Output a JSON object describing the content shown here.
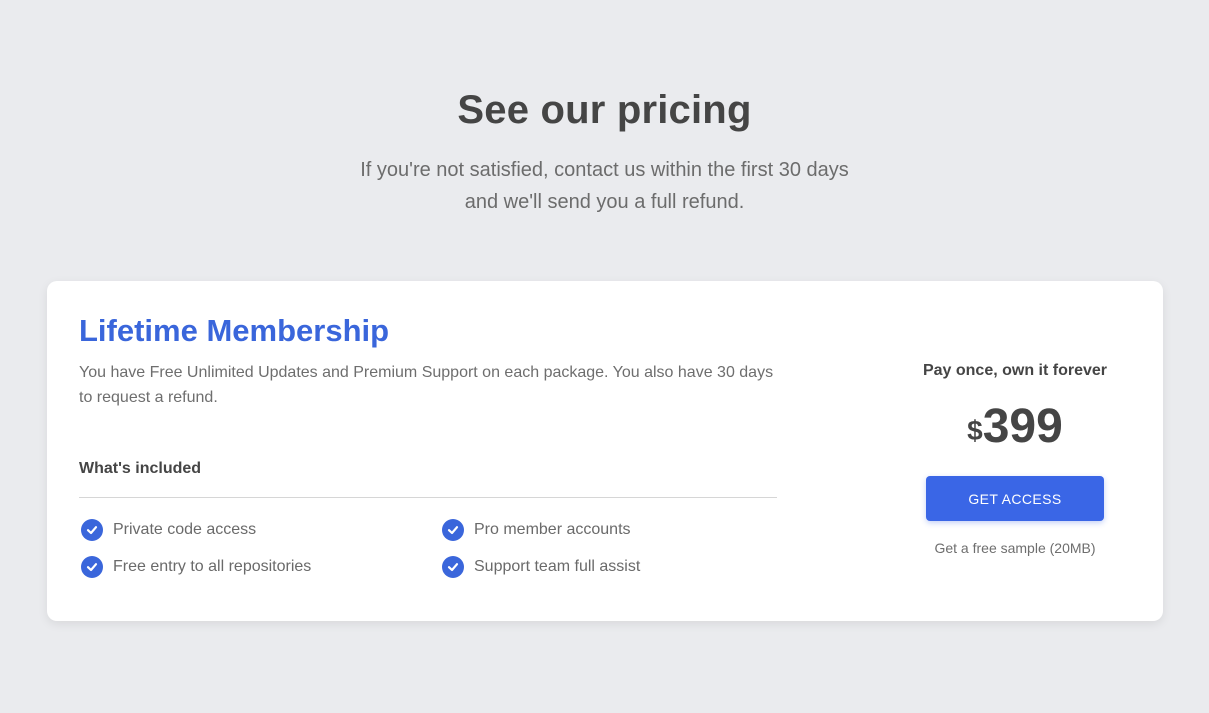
{
  "header": {
    "title": "See our pricing",
    "subtitle_line1": "If you're not satisfied, contact us within the first 30 days",
    "subtitle_line2": "and we'll send you a full refund."
  },
  "plan": {
    "name": "Lifetime Membership",
    "description": "You have Free Unlimited Updates and Premium Support on each package. You also have 30 days to request a refund.",
    "included_heading": "What's included",
    "features": [
      "Private code access",
      "Pro member accounts",
      "Free entry to all repositories",
      "Support team full assist"
    ],
    "pay_once_label": "Pay once, own it forever",
    "currency": "$",
    "price": "399",
    "cta_label": "GET ACCESS",
    "sample_link": "Get a free sample (20MB)"
  },
  "colors": {
    "accent": "#3a66db",
    "button": "#3a66e6",
    "background": "#eaebee",
    "text_dark": "#454545",
    "text_muted": "#6e6e6e"
  },
  "icons": {
    "feature_icon": "check-circle-icon"
  }
}
